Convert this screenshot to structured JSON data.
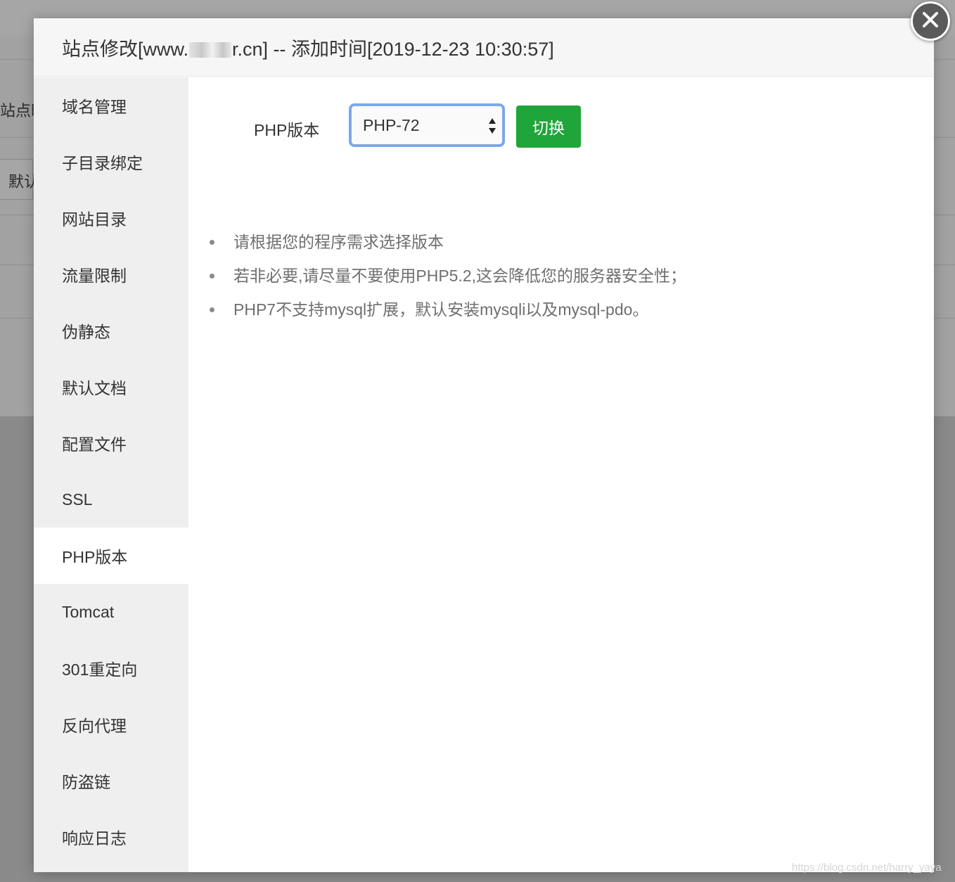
{
  "background": {
    "sidebar_partial_1": "站点时",
    "input_partial": "默认"
  },
  "modal": {
    "title_prefix": "站点修改[www.",
    "title_suffix": "r.cn] -- 添加时间[2019-12-23 10:30:57]",
    "close_icon": "close-icon"
  },
  "sidebar": {
    "items": [
      {
        "label": "域名管理"
      },
      {
        "label": "子目录绑定"
      },
      {
        "label": "网站目录"
      },
      {
        "label": "流量限制"
      },
      {
        "label": "伪静态"
      },
      {
        "label": "默认文档"
      },
      {
        "label": "配置文件"
      },
      {
        "label": "SSL"
      },
      {
        "label": "PHP版本",
        "active": true
      },
      {
        "label": "Tomcat"
      },
      {
        "label": "301重定向"
      },
      {
        "label": "反向代理"
      },
      {
        "label": "防盗链"
      },
      {
        "label": "响应日志"
      }
    ]
  },
  "php_panel": {
    "label": "PHP版本",
    "selected_version": "PHP-72",
    "switch_label": "切换",
    "tips": [
      "请根据您的程序需求选择版本",
      "若非必要,请尽量不要使用PHP5.2,这会降低您的服务器安全性；",
      "PHP7不支持mysql扩展，默认安装mysqli以及mysql-pdo。"
    ]
  },
  "watermark": "https://blog.csdn.net/harry_yaya",
  "colors": {
    "accent_green": "#20a53a",
    "focus_blue": "#77a7f2",
    "sidebar_bg": "#efefef"
  }
}
